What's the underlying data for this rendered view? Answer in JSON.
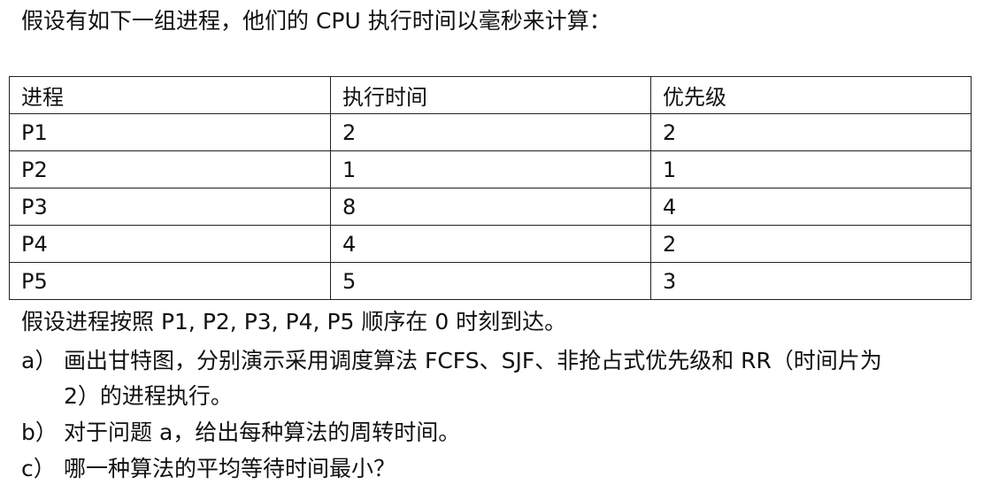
{
  "intro": "假设有如下一组进程，他们的 CPU 执行时间以毫秒来计算：",
  "table": {
    "headers": [
      "进程",
      "执行时间",
      "优先级"
    ],
    "rows": [
      [
        "P1",
        "2",
        "2"
      ],
      [
        "P2",
        "1",
        "1"
      ],
      [
        "P3",
        "8",
        "4"
      ],
      [
        "P4",
        "4",
        "2"
      ],
      [
        "P5",
        "5",
        "3"
      ]
    ]
  },
  "arrival_note": "假设进程按照 P1, P2, P3, P4, P5 顺序在 0 时刻到达。",
  "questions": [
    {
      "marker": "a）",
      "text_line1": "画出甘特图，分别演示采用调度算法 FCFS、SJF、非抢占式优先级和 RR（时间片为",
      "text_line2": "2）的进程执行。"
    },
    {
      "marker": "b）",
      "text_line1": "对于问题 a，给出每种算法的周转时间。"
    },
    {
      "marker": "c）",
      "text_line1": "哪一种算法的平均等待时间最小？"
    }
  ]
}
